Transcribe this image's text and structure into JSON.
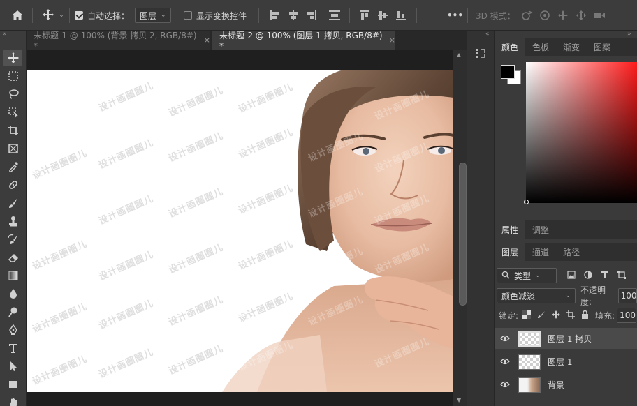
{
  "options_bar": {
    "auto_select_label": "自动选择：",
    "auto_select_checked": true,
    "auto_select_target": "图层",
    "show_transform_label": "显示变换控件",
    "show_transform_checked": false,
    "more_label": "•••",
    "mode3d_label": "3D 模式："
  },
  "tabs": [
    {
      "label": "未标题-1 @ 100% (背景 拷贝 2, RGB/8#) *",
      "close": "×",
      "active": false
    },
    {
      "label": "未标题-2 @ 100% (图层 1 拷贝, RGB/8#) *",
      "close": "×",
      "active": true
    }
  ],
  "canvas": {
    "watermark_text": "设计画圈圈儿",
    "background_color": "#ffffff"
  },
  "color_panel": {
    "tabs": [
      "颜色",
      "色板",
      "渐变",
      "图案"
    ],
    "active_tab": "颜色",
    "foreground": "#000000",
    "background": "#ffffff",
    "hue_color": "#ff1a1a"
  },
  "properties_panel": {
    "tabs": [
      "属性",
      "调整"
    ],
    "active_tab": "属性"
  },
  "layers_panel": {
    "tabs": [
      "图层",
      "通道",
      "路径"
    ],
    "active_tab": "图层",
    "filter_kind": "类型",
    "blend_mode": "颜色减淡",
    "opacity_label": "不透明度:",
    "opacity_value": "100",
    "lock_label": "锁定:",
    "fill_label": "填充:",
    "fill_value": "100",
    "layers": [
      {
        "name": "图层 1 拷贝",
        "selected": true,
        "visible": true
      },
      {
        "name": "图层 1",
        "selected": false,
        "visible": true
      },
      {
        "name": "背景",
        "selected": false,
        "visible": true
      }
    ]
  }
}
